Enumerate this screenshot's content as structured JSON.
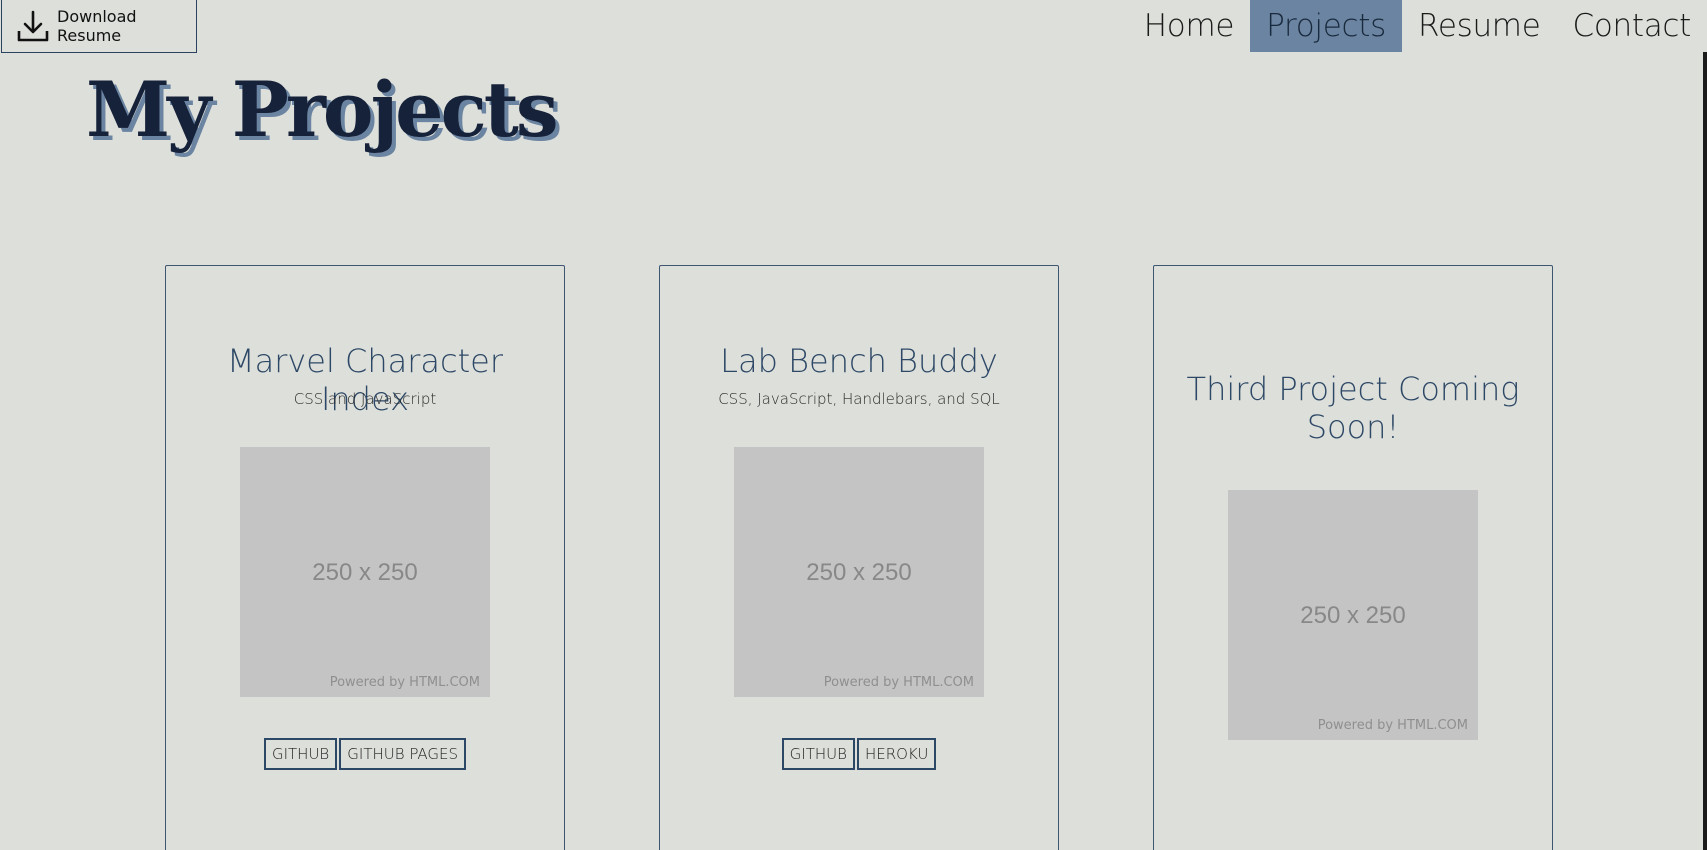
{
  "header": {
    "download_label": "Download Resume",
    "download_icon": "download-icon"
  },
  "nav": {
    "items": [
      {
        "label": "Home",
        "active": false
      },
      {
        "label": "Projects",
        "active": true
      },
      {
        "label": "Resume",
        "active": false
      },
      {
        "label": "Contact",
        "active": false
      }
    ]
  },
  "page": {
    "title": "My Projects"
  },
  "projects": [
    {
      "title": "Marvel Character Index",
      "subtitle": "CSS and JavaScript",
      "image_dims": "250 x 250",
      "image_credit": "Powered by HTML.COM",
      "buttons": [
        "GITHUB",
        "GITHUB PAGES"
      ]
    },
    {
      "title": "Lab Bench Buddy",
      "subtitle": "CSS, JavaScript, Handlebars, and SQL",
      "image_dims": "250 x 250",
      "image_credit": "Powered by HTML.COM",
      "buttons": [
        "GITHUB",
        "HEROKU"
      ]
    },
    {
      "title": "Third Project Coming Soon!",
      "image_dims": "250 x 250",
      "image_credit": "Powered by HTML.COM"
    }
  ],
  "colors": {
    "background": "#dddfda",
    "accent": "#6a84a1",
    "title_text": "#16213a",
    "card_title": "#2d4866"
  }
}
